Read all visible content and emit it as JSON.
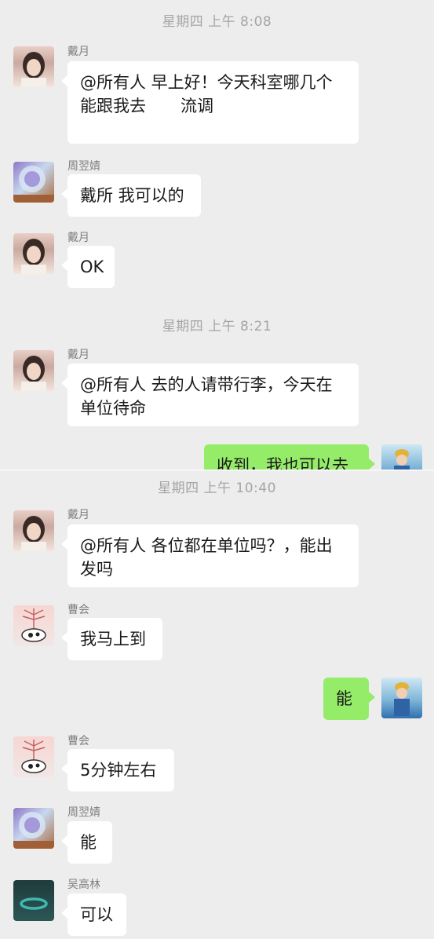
{
  "panel1": {
    "time1": "星期四 上午 8:08",
    "msg1": {
      "sender": "戴月",
      "line1": "@所有人 早上好！今天科室哪几个",
      "line2_a": "能跟我去",
      "line2_b": "流调"
    },
    "msg2": {
      "sender": "周翌婧",
      "text": "戴所 我可以的"
    },
    "msg3": {
      "sender": "戴月",
      "text": "OK"
    },
    "time2": "星期四 上午 8:21",
    "msg4": {
      "sender": "戴月",
      "line1": "@所有人 去的人请带行李，今天在",
      "line2": "单位待命"
    },
    "msg5": {
      "text": "收到，我也可以去"
    }
  },
  "panel2": {
    "time1": "星期四 上午 10:40",
    "msg1": {
      "sender": "戴月",
      "line1": "@所有人 各位都在单位吗？，能出",
      "line2": "发吗"
    },
    "msg2": {
      "sender": "曹会",
      "text": "我马上到"
    },
    "msg3": {
      "text": "能"
    },
    "msg4": {
      "sender": "曹会",
      "text": "5分钟左右"
    },
    "msg5": {
      "sender": "周翌婧",
      "text": "能"
    },
    "msg6": {
      "sender": "吴高林",
      "text": "可以"
    }
  },
  "colors": {
    "background": "#ededed",
    "bubble_in": "#ffffff",
    "bubble_out": "#95ec69",
    "timestamp": "#a5a5a5",
    "sender": "#7f7f7f"
  }
}
